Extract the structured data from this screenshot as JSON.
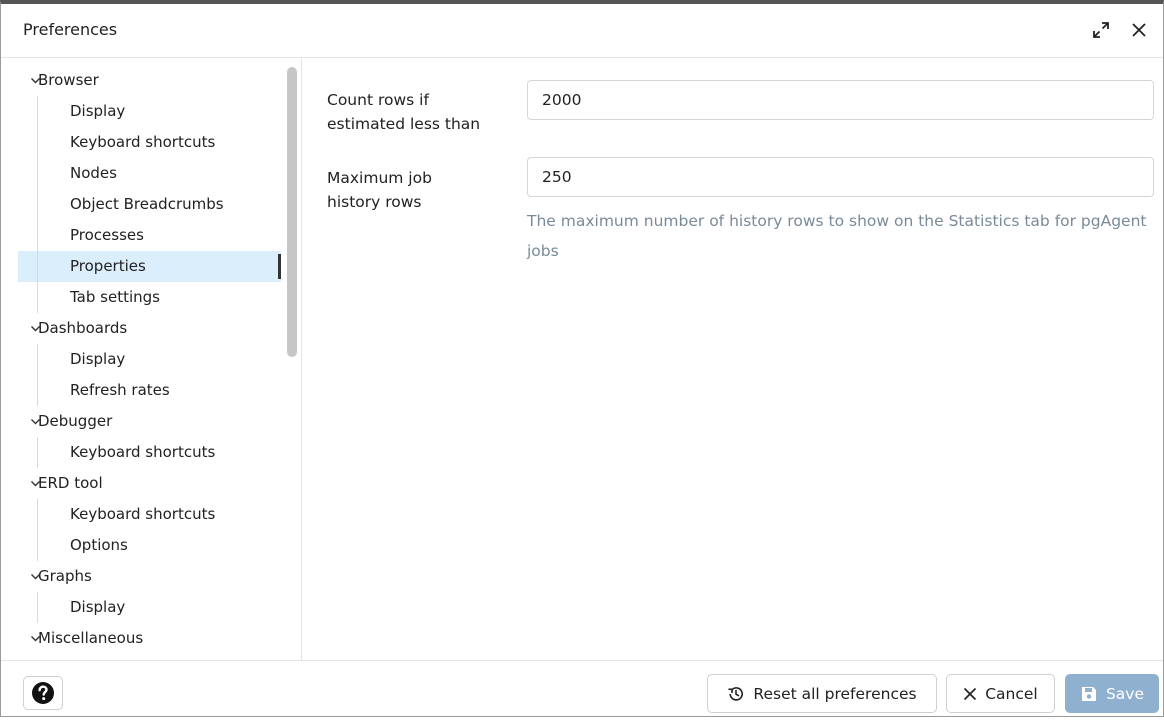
{
  "dialog": {
    "title": "Preferences"
  },
  "tree": [
    {
      "type": "group",
      "label": "Browser"
    },
    {
      "type": "child",
      "label": "Display"
    },
    {
      "type": "child",
      "label": "Keyboard shortcuts"
    },
    {
      "type": "child",
      "label": "Nodes"
    },
    {
      "type": "child",
      "label": "Object Breadcrumbs"
    },
    {
      "type": "child",
      "label": "Processes"
    },
    {
      "type": "child",
      "label": "Properties",
      "selected": true
    },
    {
      "type": "child",
      "label": "Tab settings"
    },
    {
      "type": "group",
      "label": "Dashboards"
    },
    {
      "type": "child",
      "label": "Display"
    },
    {
      "type": "child",
      "label": "Refresh rates"
    },
    {
      "type": "group",
      "label": "Debugger"
    },
    {
      "type": "child",
      "label": "Keyboard shortcuts"
    },
    {
      "type": "group",
      "label": "ERD tool"
    },
    {
      "type": "child",
      "label": "Keyboard shortcuts"
    },
    {
      "type": "child",
      "label": "Options"
    },
    {
      "type": "group",
      "label": "Graphs"
    },
    {
      "type": "child",
      "label": "Display"
    },
    {
      "type": "group",
      "label": "Miscellaneous"
    }
  ],
  "form": {
    "count_rows": {
      "label_line1": "Count rows if",
      "label_line2": "estimated less than",
      "value": "2000"
    },
    "max_job_history": {
      "label_line1": "Maximum job",
      "label_line2": "history rows",
      "value": "250",
      "help": "The maximum number of history rows to show on the Statistics tab for pgAgent jobs"
    }
  },
  "footer": {
    "reset_label": "Reset all preferences",
    "cancel_label": "Cancel",
    "save_label": "Save"
  },
  "colors": {
    "selected_bg": "#dbeefb",
    "save_bg": "#8fb0ce",
    "help_text": "#7a8a99"
  },
  "icons": {
    "expand": "expand-icon",
    "close": "close-icon",
    "help": "question-circle-icon",
    "reset": "history-icon",
    "cancel": "close-icon",
    "save": "floppy-disk-icon"
  }
}
